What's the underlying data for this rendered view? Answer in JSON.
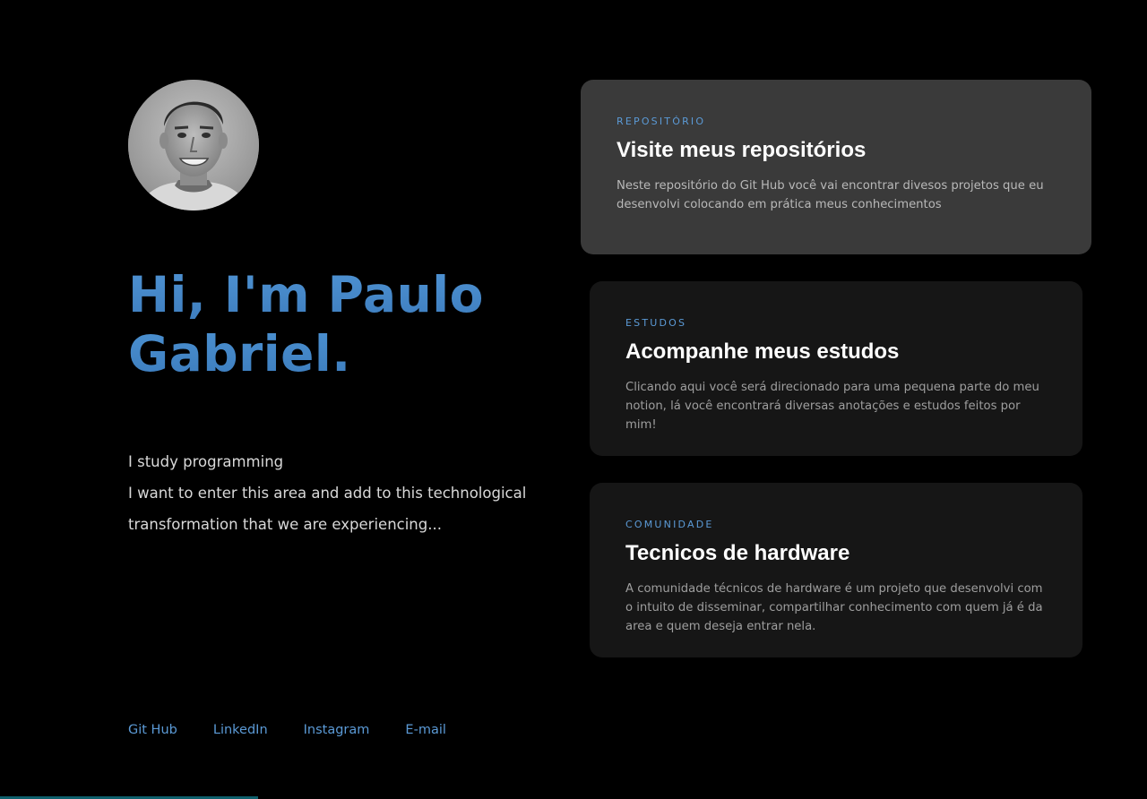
{
  "profile": {
    "avatar_icon": "profile-photo",
    "title_line1": "Hi, I'm Paulo",
    "title_line2": "Gabriel.",
    "bio_line1": "I study programming",
    "bio_line2": "I want to enter this area and add to this technological transformation that we are experiencing..."
  },
  "links": [
    {
      "label": "Git Hub"
    },
    {
      "label": "LinkedIn"
    },
    {
      "label": "Instagram"
    },
    {
      "label": "E-mail"
    }
  ],
  "cards": [
    {
      "kicker": "REPOSITÓRIO",
      "title": "Visite meus repositórios",
      "description": "Neste repositório do Git Hub você vai encontrar divesos projetos que eu desenvolvi colocando em prática meus conhecimentos"
    },
    {
      "kicker": "ESTUDOS",
      "title": "Acompanhe meus estudos",
      "description": "Clicando aqui você será direcionado para uma pequena parte do meu notion, lá você encontrará diversas anotações e estudos feitos por mim!"
    },
    {
      "kicker": "COMUNIDADE",
      "title": "Tecnicos de hardware",
      "description": "A comunidade técnicos de hardware é um projeto que desenvolvi com o intuito de disseminar, compartilhar conhecimento com quem já é da area e quem deseja entrar nela."
    }
  ],
  "colors": {
    "background": "#000000",
    "accent": "#5b9ad6",
    "title_blue": "#4a8cc9",
    "card_active": "#3a3a3a",
    "card": "#161616"
  }
}
